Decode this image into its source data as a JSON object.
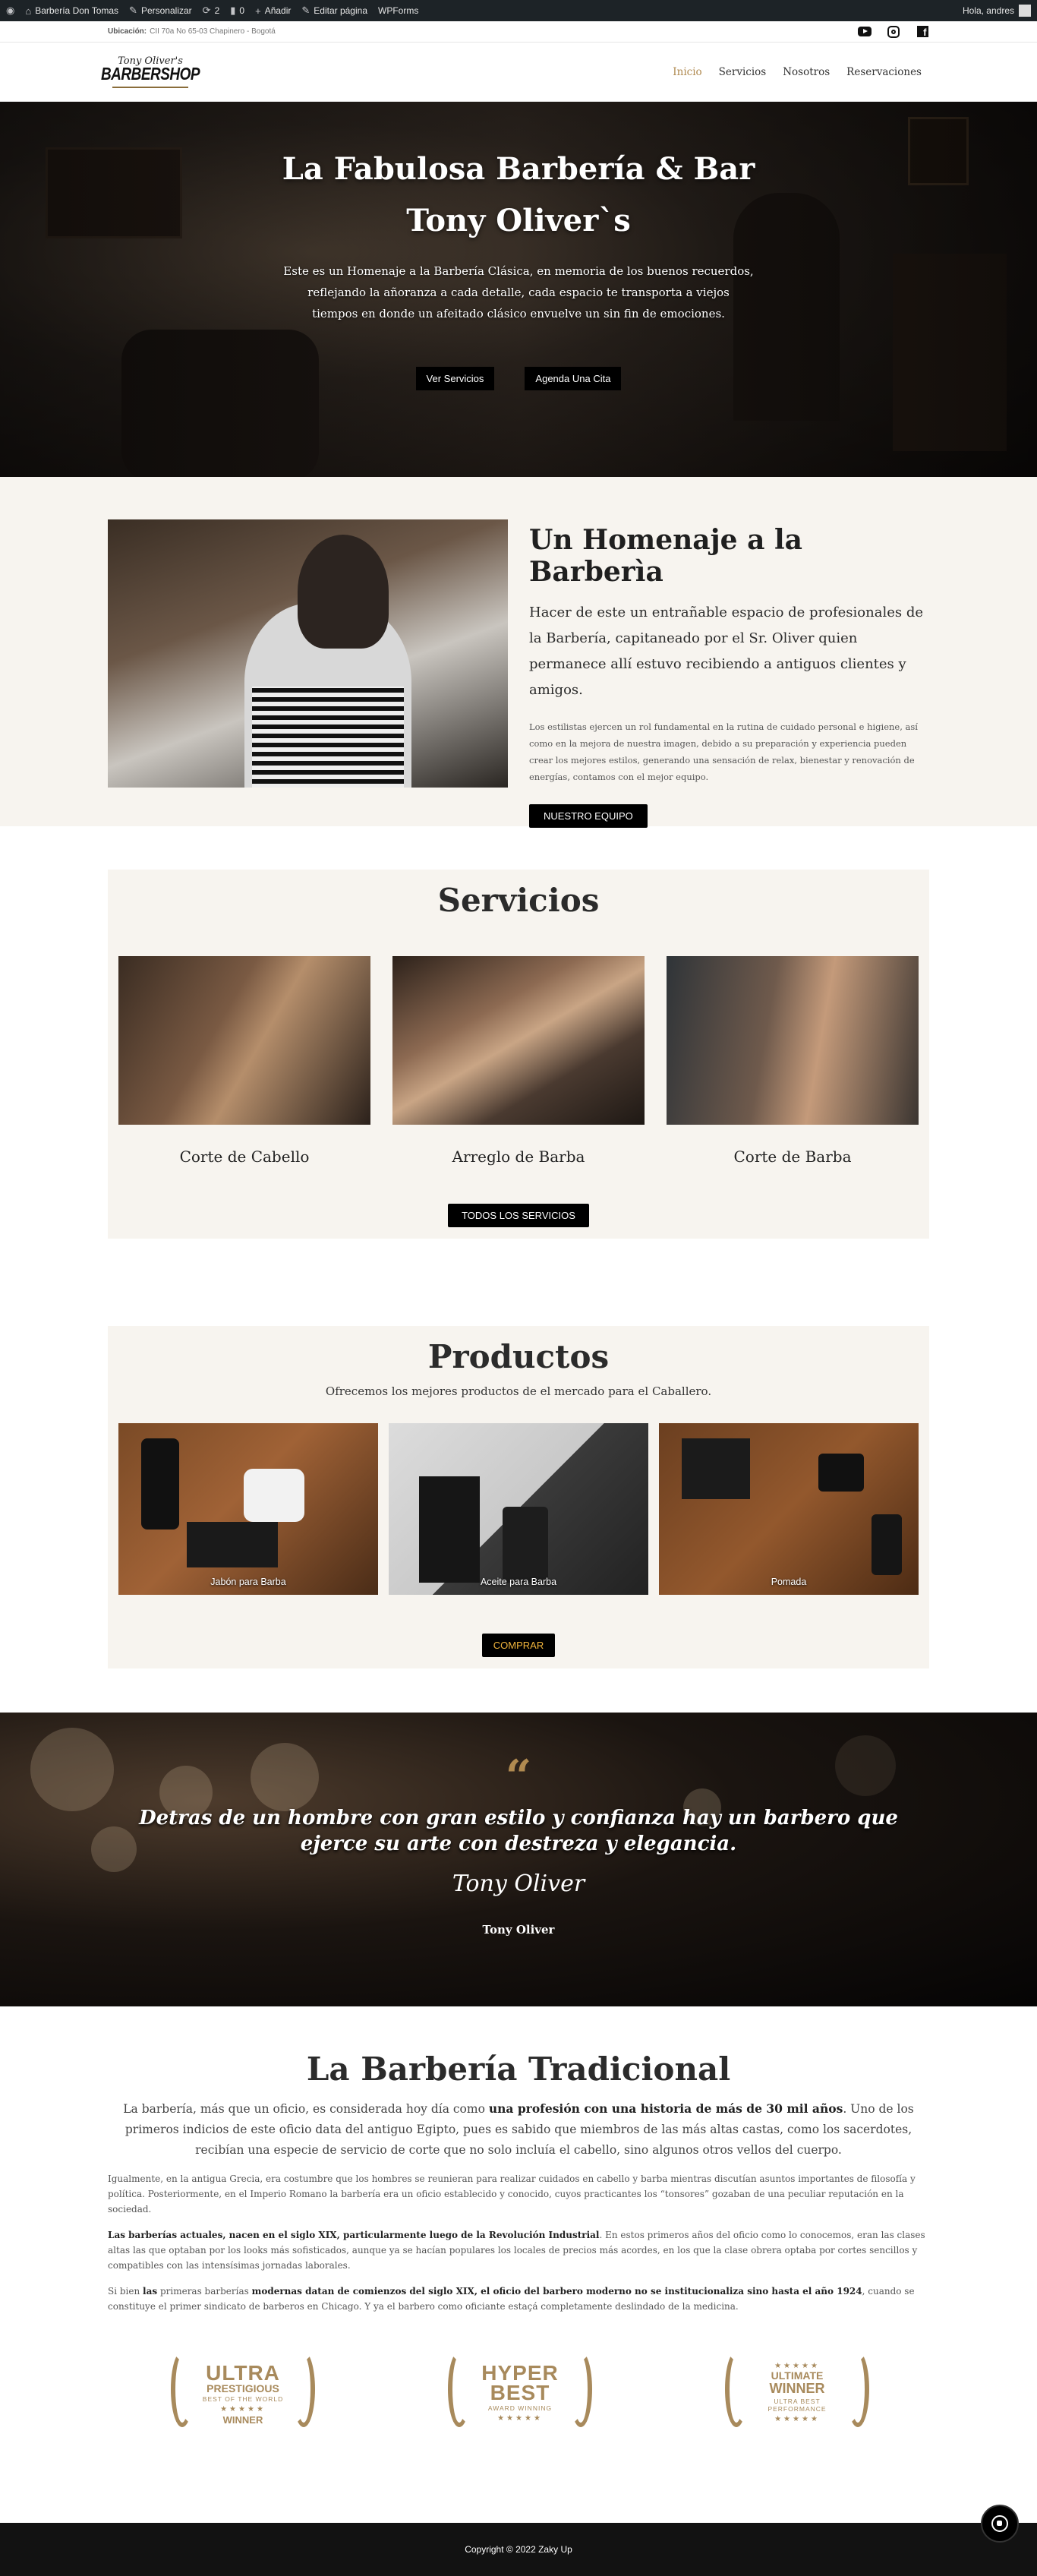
{
  "adminbar": {
    "wp_logo_icon": "wordpress-icon",
    "site_name": "Barbería Don Tomas",
    "customize": "Personalizar",
    "updates_count": "2",
    "comments_count": "0",
    "new_label": "Añadir",
    "edit_page": "Editar página",
    "wpforms": "WPForms",
    "greeting": "Hola, andres"
  },
  "infobar": {
    "location_label": "Ubicación:",
    "location_value": "CII 70a No 65-03 Chapinero - Bogotá",
    "social": [
      "youtube-icon",
      "instagram-icon",
      "facebook-icon"
    ]
  },
  "header": {
    "logo_script": "Tony Oliver's",
    "logo_main": "BARBERSHOP",
    "nav": [
      "Inicio",
      "Servicios",
      "Nosotros",
      "Reservaciones"
    ],
    "active_index": 0
  },
  "hero": {
    "title_line1": "La Fabulosa Barbería & Bar",
    "title_line2": "Tony Oliver`s",
    "description": "Este es un Homenaje a la Barbería Clásica, en memoria de los buenos recuerdos, reflejando la añoranza a cada detalle, cada espacio te transporta a viejos tiempos en donde un afeitado clásico envuelve un sin fin de emociones.",
    "btn_services": "Ver Servicios",
    "btn_appointment": "Agenda Una Cita"
  },
  "homenaje": {
    "title": "Un Homenaje a la Barberìa",
    "lead": "Hacer de este un entrañable espacio de profesionales de la Barbería, capitaneado por el Sr. Oliver quien permanece allí estuvo recibiendo a antiguos clientes y amigos.",
    "body": "Los estilistas ejercen un rol fundamental en la rutina de cuidado personal e higiene, así como en la mejora de nuestra imagen, debido a su preparación y experiencia pueden crear los mejores estilos, generando una sensación de relax, bienestar y renovación de energías, contamos con el mejor equipo.",
    "button": "NUESTRO EQUIPO"
  },
  "servicios": {
    "title": "Servicios",
    "items": [
      "Corte de Cabello",
      "Arreglo de Barba",
      "Corte de Barba"
    ],
    "button": "TODOS LOS SERVICIOS"
  },
  "productos": {
    "title": "Productos",
    "subtitle": "Ofrecemos los mejores productos de el mercado para el Caballero.",
    "items": [
      "Jabón para Barba",
      "Aceite para Barba",
      "Pomada"
    ],
    "button": "COMPRAR",
    "button_color": "#f0b43c"
  },
  "quote": {
    "text": "Detras de un hombre con gran estilo y confianza hay un barbero que ejerce su arte con destreza y elegancia.",
    "signature": "Tony Oliver",
    "author": "Tony Oliver"
  },
  "tradicional": {
    "title": "La Barbería Tradicional",
    "intro_a": "La barbería, más que un oficio, es considerada hoy día como ",
    "intro_b": "una profesión con una historia de más de 30 mil años",
    "intro_c": ". Uno de los primeros indicios de este oficio data del antiguo Egipto, pues es sabido que miembros de las más altas castas, como los sacerdotes, recibían una especie de servicio de corte que no solo incluía el cabello, sino algunos otros vellos del cuerpo.",
    "p1_a": "Igualmente, en la antigua Grecia, era costumbre que los hombres se reunieran para realizar cuidados en cabello y barba mientras discutían asuntos importantes de filosofía y política. Posteriormente, en el Imperio Romano la barbería era un oficio establecido y conocido, cuyos practicantes los “tonsores” gozaban de una peculiar reputación en la sociedad.",
    "p2_a": "Las barberías actuales, nacen en el siglo XIX, particularmente luego de la Revolución Industrial",
    "p2_b": ". En estos primeros años del oficio como lo conocemos, eran las clases altas las que optaban por los looks más sofisticados, aunque ya se hacían populares los locales de precios más acordes, en los que la clase obrera optaba por cortes sencillos y compatibles con las intensísimas jornadas laborales.",
    "p3_a": "Si bien ",
    "p3_b": "las",
    "p3_c": " primeras barberías ",
    "p3_d": "modernas datan de comienzos del siglo XIX, el oficio del barbero moderno no se institucionaliza sino hasta el año 1924",
    "p3_e": ", cuando se constituye el primer sindicato de barberos en Chicago. Y ya el barbero como oficiante estaçá completamente deslindado de la medicina."
  },
  "awards": [
    {
      "l1": "ULTRA",
      "l2": "PRESTIGIOUS",
      "l3": "BEST OF THE WORLD",
      "l4": "WINNER"
    },
    {
      "l1": "HYPER",
      "l2": "BEST",
      "l3": "AWARD WINNING",
      "l4": ""
    },
    {
      "l1": "ULTIMATE",
      "l2": "WINNER",
      "l3": "ULTRA BEST PERFORMANCE",
      "l4": ""
    }
  ],
  "footer": {
    "copyright": "Copyright © 2022 Zaky Up",
    "whatsapp_icon": "whatsapp-icon"
  }
}
